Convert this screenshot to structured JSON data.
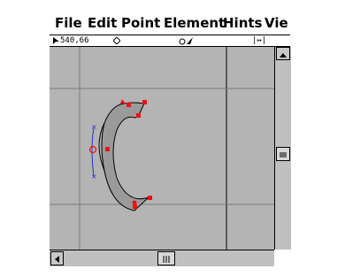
{
  "menu": {
    "file": "File",
    "edit": "Edit",
    "point": "Point",
    "element": "Element",
    "hints": "Hints",
    "view": "Vie"
  },
  "toolbar": {
    "coordinates": "540,66",
    "width_indicator": "|↔|"
  },
  "glyph": {
    "character": "C"
  },
  "colors": {
    "canvas": "#b4b4b4",
    "grid": "#7a7a7a",
    "glyph_fill": "#9a9a9a",
    "point": "#ee1111",
    "hint": "#2233cc"
  },
  "icons": {
    "pointer": "pointer-icon",
    "diamond": "diamond-icon",
    "curve_tool": "curve-tool-icon",
    "scroll_up": "arrow-up-icon",
    "scroll_left": "arrow-left-icon"
  }
}
